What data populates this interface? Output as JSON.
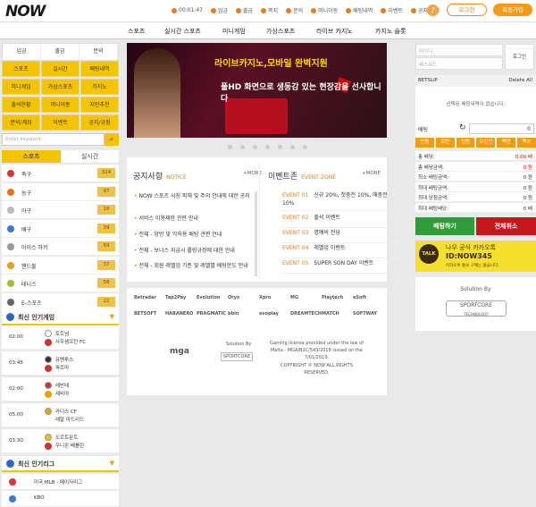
{
  "header": {
    "logo": "NOW",
    "clock": "00:01:47",
    "nav": [
      "입금",
      "출금",
      "쪽지",
      "문의",
      "머니이동",
      "배팅내역",
      "이벤트",
      "공지/규정"
    ],
    "login": "로그인",
    "join": "회원가입"
  },
  "mainnav": [
    "스포츠",
    "실시간 스포츠",
    "미니게임",
    "가상스포츠",
    "라이브 카지노",
    "카지노 슬롯"
  ],
  "left": {
    "account": [
      "입금",
      "출금",
      "문의"
    ],
    "grid": [
      "스포츠",
      "실시간",
      "배팅내역",
      "미니게임",
      "가상스포츠",
      "카지노",
      "출석현황",
      "머니이동",
      "지인추천",
      "문의/계좌",
      "이벤트",
      "공지/규정"
    ],
    "keyword_placeholder": "Enter keyword",
    "tabs": [
      "스포츠",
      "실시간"
    ],
    "sports": [
      {
        "name": "축구",
        "count": "324",
        "color": "#d33"
      },
      {
        "name": "농구",
        "count": "97",
        "color": "#e8701a"
      },
      {
        "name": "야구",
        "count": "18",
        "color": "#bbb"
      },
      {
        "name": "배구",
        "count": "39",
        "color": "#3a7bd5"
      },
      {
        "name": "아이스 하키",
        "count": "59",
        "color": "#999"
      },
      {
        "name": "핸드볼",
        "count": "37",
        "color": "#e3a21a"
      },
      {
        "name": "테니스",
        "count": "58",
        "color": "#9bc02e"
      },
      {
        "name": "E-스포츠",
        "count": "22",
        "color": "#666"
      }
    ],
    "games_title": "최신 인기게임",
    "games": [
      {
        "time": "02:00",
        "t1": "토트넘",
        "t2": "사우샘프턴 FC"
      },
      {
        "time": "03:45",
        "t1": "유벤투스",
        "t2": "파르마"
      },
      {
        "time": "02:00",
        "t1": "레반테",
        "t2": "세비야"
      },
      {
        "time": "05:00",
        "t1": "카디스 CF",
        "t2": "레알 마드리드"
      },
      {
        "time": "03:30",
        "t1": "도르트문트",
        "t2": "우니온 베를린"
      }
    ],
    "leagues_title": "최신 인기리그",
    "leagues": [
      "미국 MLB - 메이저리그",
      "KBO"
    ]
  },
  "banner": {
    "line1": "라이브카지노,모바일 완벽지원",
    "line2": "풀HD 화면으로 생동감 있는 현장감을 선사합니다"
  },
  "notice": {
    "title": "공지사항",
    "sub": "NOTICE",
    "more": "+MORE",
    "items": [
      "NOW 스포츠 사칭 피해 및 주의 안내에 대한 공지",
      "서비스 이용제한 관련 안내",
      "전체 - 양방 및 악의용 배팅 관련 안내",
      "전체 - 보너스 지급시 롤링규정에 대한 안내",
      "전체 - 회원 레벨업 기준 및 레벨별 배팅한도 안내"
    ]
  },
  "events": {
    "title": "이벤트존",
    "sub": "EVENT ZONE",
    "more": "+MORE",
    "items": [
      {
        "no": "EVENT 01",
        "text": "신규 20%, 첫충전 10%, 매충전 10%"
      },
      {
        "no": "EVENT 02",
        "text": "출석 이벤트"
      },
      {
        "no": "EVENT 03",
        "text": "명예의 전당"
      },
      {
        "no": "EVENT 04",
        "text": "레벨업 이벤트"
      },
      {
        "no": "EVENT 05",
        "text": "SUPER SON DAY 이벤트"
      }
    ]
  },
  "footer": {
    "brands": [
      "Betradar",
      "Tap2Pay",
      "Evolution",
      "Oryx",
      "Xpro",
      "MG",
      "Playtech",
      "eSoft",
      "BETSOFT",
      "HABANERO",
      "PRAGMATIC",
      "bbin",
      "evoplay",
      "DREAMTECH",
      "MATCH",
      "SOFTWAY"
    ],
    "mga": "mga",
    "solution": "Solution By",
    "sportcore": "SPORTCORE",
    "license": "Gaming license provided under the law of Malta - MGA/B2C/543/2018 issued on the 7/01/2019.",
    "copyright": "COPYRIGHT © NOW ALL RIGHTS RESERVED."
  },
  "right": {
    "id_placeholder": "아이디",
    "pw_placeholder": "패스워드",
    "login": "로그인",
    "betslip": "BETSLIP",
    "delete_all": "Delete All",
    "empty": "선택된 배팅내역이 없습니다.",
    "bet_label": "배팅",
    "bet_value": "0",
    "chips": [
      "만원",
      "오만",
      "십만",
      "오십만",
      "백만",
      "맥스"
    ],
    "summary": [
      {
        "label": "총 배당:",
        "value": "0.00 배",
        "red": true
      },
      {
        "label": "총 배당금액:",
        "value": "0 원",
        "red": true
      },
      {
        "label": "최소 배팅금액:",
        "value": "0 원"
      },
      {
        "label": "최대 배팅금액:",
        "value": "0 원"
      },
      {
        "label": "최대 당첨금액:",
        "value": "0 원"
      },
      {
        "label": "최대 배팅배당:",
        "value": "0 배"
      }
    ],
    "bet_btn": "배팅하기",
    "clear_btn": "전체취소",
    "talk_icon": "TALK",
    "talk1": "나우 공식 카카오톡",
    "talk2": "ID:NOW345",
    "talk3": "카카오톡 통보 구매는 없습니다.",
    "solution": "Solution By",
    "sportcore": "SPORTCORE",
    "tech": "TECHNOLOGY"
  },
  "colors": {
    "accent": "#f39b15",
    "yellow": "#f5c400"
  }
}
